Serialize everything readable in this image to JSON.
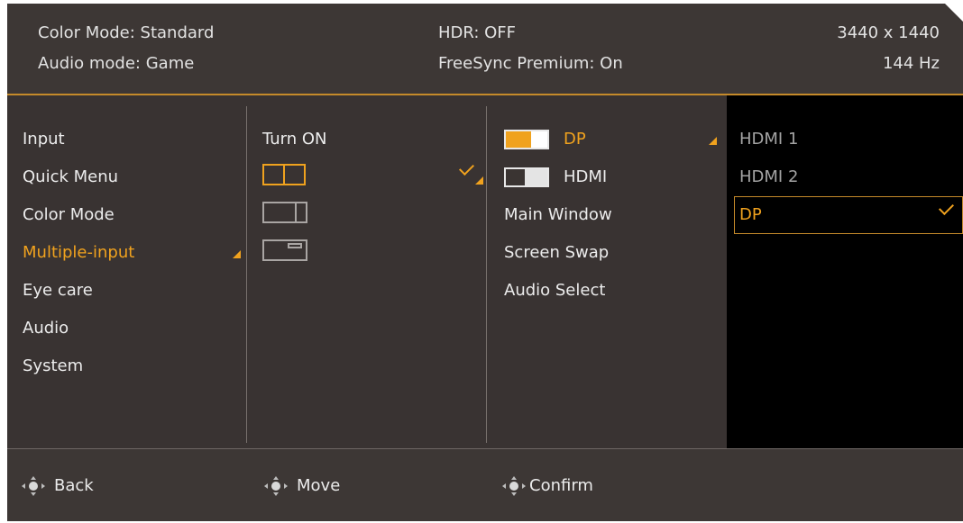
{
  "header": {
    "color_mode": "Color Mode: Standard",
    "audio_mode": "Audio mode: Game",
    "hdr": "HDR: OFF",
    "freesync": "FreeSync Premium: On",
    "resolution": "3440 x 1440",
    "refresh_rate": "144 Hz"
  },
  "main_menu": {
    "items": [
      {
        "label": "Input"
      },
      {
        "label": "Quick Menu"
      },
      {
        "label": "Color Mode"
      },
      {
        "label": "Multiple-input"
      },
      {
        "label": "Eye care"
      },
      {
        "label": "Audio"
      },
      {
        "label": "System"
      }
    ],
    "selected_index": 3
  },
  "multi_input_menu": {
    "turn_on_label": "Turn ON",
    "layout_icons": [
      "pbp-split-icon",
      "pbp-unequal-split-icon",
      "pip-icon"
    ],
    "selected_layout": "pbp-split-icon"
  },
  "source_menu": {
    "items": [
      {
        "label": "DP",
        "toggle": "on",
        "icon": "dp-toggle-icon"
      },
      {
        "label": "HDMI",
        "toggle": "off",
        "icon": "hdmi-toggle-icon"
      },
      {
        "label": "Main Window"
      },
      {
        "label": "Screen Swap"
      },
      {
        "label": "Audio Select"
      }
    ]
  },
  "sub_menu": {
    "items": [
      {
        "label": "HDMI 1"
      },
      {
        "label": "HDMI 2"
      },
      {
        "label": "DP"
      }
    ],
    "selected_label": "DP"
  },
  "footer": {
    "back": "Back",
    "move": "Move",
    "confirm": "Confirm"
  },
  "colors": {
    "accent": "#f0a21e",
    "background": "#3d3735",
    "sub_panel": "#000000"
  }
}
